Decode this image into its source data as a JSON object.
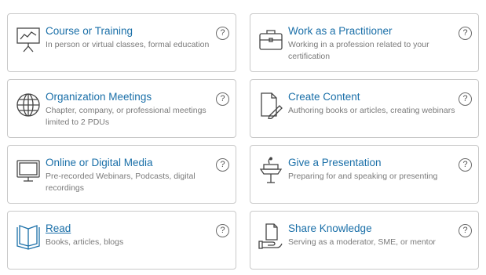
{
  "cards": [
    {
      "title": "Course or Training",
      "description": "In person or virtual classes, formal education",
      "help": "?"
    },
    {
      "title": "Work as a Practitioner",
      "description": "Working in a profession related to your certification",
      "help": "?"
    },
    {
      "title": "Organization Meetings",
      "description": "Chapter, company, or professional meetings limited to 2 PDUs",
      "help": "?"
    },
    {
      "title": "Create Content",
      "description": "Authoring books or articles, creating webinars",
      "help": "?"
    },
    {
      "title": "Online or Digital Media",
      "description": "Pre-recorded Webinars, Podcasts, digital recordings",
      "help": "?"
    },
    {
      "title": "Give a Presentation",
      "description": "Preparing for and speaking or presenting",
      "help": "?"
    },
    {
      "title": "Read",
      "description": "Books, articles, blogs",
      "help": "?"
    },
    {
      "title": "Share Knowledge",
      "description": "Serving as a moderator, SME, or mentor",
      "help": "?"
    }
  ],
  "icons": [
    "presentation-board-icon",
    "briefcase-icon",
    "globe-icon",
    "document-pen-icon",
    "monitor-icon",
    "podium-icon",
    "open-book-icon",
    "hand-document-icon"
  ],
  "colors": {
    "title": "#1a6fa8",
    "description": "#7a7a7a",
    "border": "#c9c9c9",
    "icon": "#444444"
  }
}
